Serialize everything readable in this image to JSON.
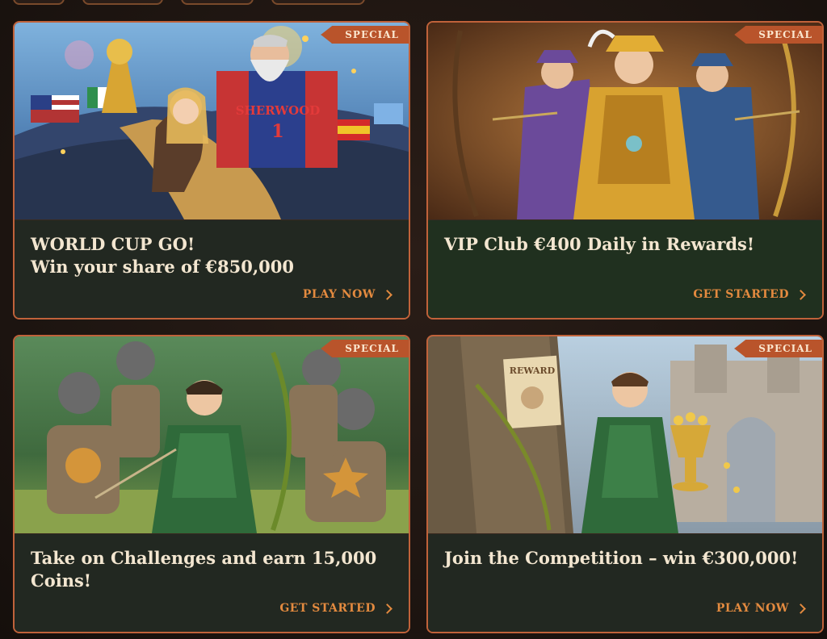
{
  "badge_label": "SPECIAL",
  "colors": {
    "card_border": "#c0623a",
    "badge_bg": "#b9542b",
    "cta_text": "#e38a3f",
    "title_text": "#f3e6d0",
    "card_body": "#222821",
    "page_bg": "#1e1512"
  },
  "cards": [
    {
      "title_line1": "WORLD CUP GO!",
      "title_line2": "Win your share of €850,000",
      "cta": "PLAY NOW",
      "cta_icon": "chevron-right-icon",
      "jersey_text": "SHERWOOD",
      "jersey_number": "1"
    },
    {
      "title_line1": "VIP Club €400 Daily in Rewards!",
      "title_line2": "",
      "cta": "GET STARTED",
      "cta_icon": "chevron-right-icon"
    },
    {
      "title_line1": "Take on Challenges and earn 15,000",
      "title_line2": "Coins!",
      "cta": "GET STARTED",
      "cta_icon": "chevron-right-icon"
    },
    {
      "title_line1": "Join the Competition – win €300,000!",
      "title_line2": "",
      "cta": "PLAY NOW",
      "cta_icon": "chevron-right-icon",
      "poster_text": "REWARD"
    }
  ]
}
